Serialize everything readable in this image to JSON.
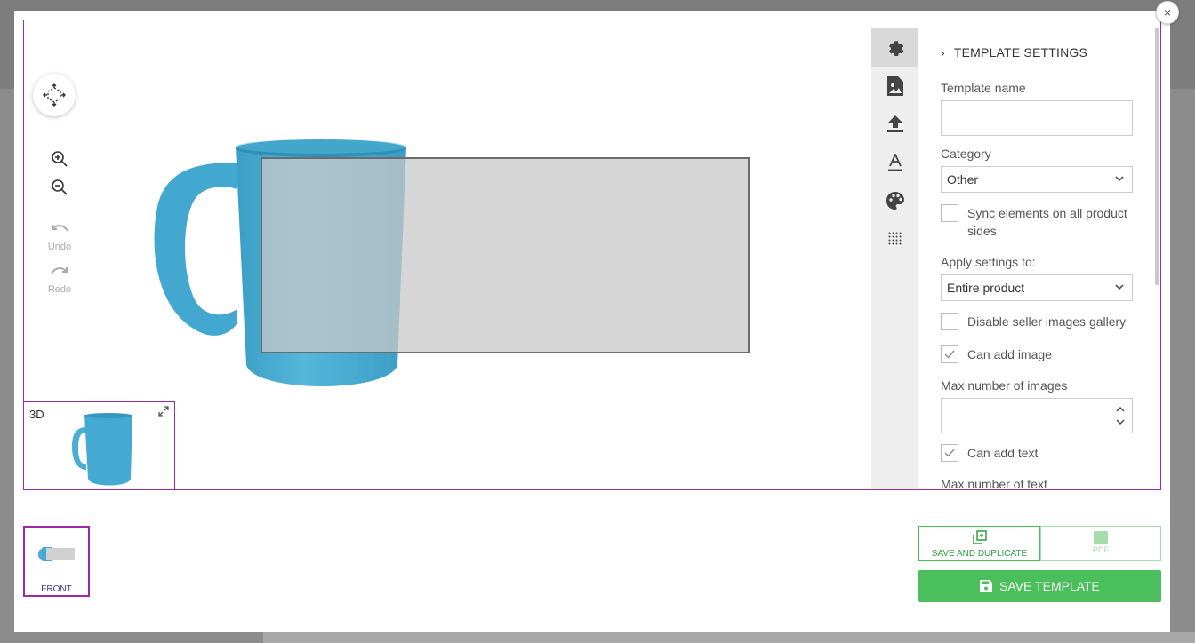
{
  "colors": {
    "accent": "#4bbf5b",
    "frame": "#9b2aa6",
    "mug": "#4aa8cc"
  },
  "close": {
    "glyph": "×"
  },
  "canvas": {
    "rotate_icon": "3d-rotate-icon",
    "zoom_in_icon": "zoom-in-icon",
    "zoom_out_icon": "zoom-out-icon",
    "undo_label": "Undo",
    "redo_label": "Redo",
    "preview_label": "3D",
    "expand_icon": "expand-icon"
  },
  "tools": [
    {
      "name": "settings",
      "icon": "gear-icon",
      "active": true
    },
    {
      "name": "image",
      "icon": "image-icon"
    },
    {
      "name": "upload",
      "icon": "upload-icon"
    },
    {
      "name": "text",
      "icon": "text-icon"
    },
    {
      "name": "color",
      "icon": "palette-icon"
    },
    {
      "name": "pattern",
      "icon": "dots-grid-icon"
    }
  ],
  "settings": {
    "section_title": "TEMPLATE SETTINGS",
    "template_name_label": "Template name",
    "template_name_value": "",
    "category_label": "Category",
    "category_value": "Other",
    "sync_label": "Sync elements on all product sides",
    "sync_checked": false,
    "apply_label": "Apply settings to:",
    "apply_value": "Entire product",
    "disable_gallery_label": "Disable seller images gallery",
    "disable_gallery_checked": false,
    "can_add_image_label": "Can add image",
    "can_add_image_checked": true,
    "max_images_label": "Max number of images",
    "max_images_value": "",
    "can_add_text_label": "Can add text",
    "can_add_text_checked": true,
    "max_text_label": "Max number of text"
  },
  "sides": [
    {
      "label": "FRONT",
      "selected": true
    }
  ],
  "actions": {
    "duplicate_label": "SAVE AND DUPLICATE",
    "pdf_label": "PDF",
    "save_label": "SAVE TEMPLATE"
  }
}
